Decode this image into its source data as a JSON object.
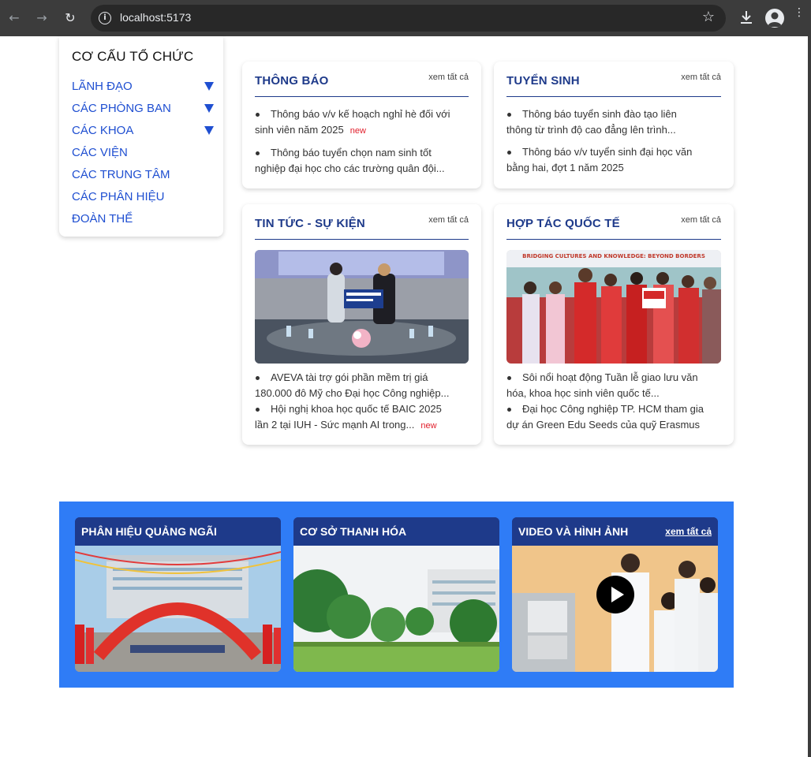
{
  "browser": {
    "url": "localhost:5173",
    "icons": [
      "back-icon",
      "forward-icon",
      "reload-icon",
      "info-icon",
      "star-icon",
      "download-icon",
      "profile-icon",
      "kebab-menu-icon"
    ]
  },
  "sidebar": {
    "title": "CƠ CẤU TỔ CHỨC",
    "items": [
      {
        "label": "LÃNH ĐẠO",
        "expandable": true
      },
      {
        "label": "CÁC PHÒNG BAN",
        "expandable": true
      },
      {
        "label": "CÁC KHOA",
        "expandable": true
      },
      {
        "label": "CÁC VIỆN",
        "expandable": false
      },
      {
        "label": "CÁC TRUNG TÂM",
        "expandable": false
      },
      {
        "label": "CÁC PHÂN HIỆU",
        "expandable": false
      },
      {
        "label": "ĐOÀN THỂ",
        "expandable": false
      }
    ]
  },
  "sections": {
    "thong_bao": {
      "title": "THÔNG BÁO",
      "more": "xem tất cả",
      "items": [
        {
          "line1": "Thông báo v/v kế hoạch nghỉ hè đối với",
          "line2": "sinh viên năm 2025",
          "tag": "new"
        },
        {
          "line1": "Thông báo tuyển chọn nam sinh tốt",
          "line2": "nghiệp đại học cho các trường quân đội..."
        }
      ]
    },
    "tuyen_sinh": {
      "title": "TUYỂN SINH",
      "more": "xem tất cả",
      "items": [
        {
          "line1": "Thông báo tuyển sinh đào tạo liên",
          "line2": "thông từ trình độ cao đẳng lên trình..."
        },
        {
          "line1": "Thông báo v/v tuyển sinh đại học văn",
          "line2": "bằng hai, đợt 1 năm 2025"
        }
      ]
    },
    "tin_tuc": {
      "title": "TIN TỨC - SỰ KIỆN",
      "more": "xem tất cả",
      "items": [
        {
          "line1": "AVEVA tài trợ gói phần mềm trị giá",
          "line2": "180.000 đô Mỹ cho Đại học Công nghiệp..."
        },
        {
          "line1": "Hội nghị khoa học quốc tế BAIC 2025",
          "line2": "lần 2 tại IUH - Sức mạnh AI trong...",
          "tag": "new"
        }
      ]
    },
    "hop_tac": {
      "title": "HỢP TÁC QUỐC TẾ",
      "more": "xem tất cả",
      "banner": "BRIDGING CULTURES AND KNOWLEDGE: BEYOND BORDERS",
      "items": [
        {
          "line1": "Sôi nổi hoạt động Tuần lễ giao lưu văn",
          "line2": "hóa, khoa học sinh viên quốc tế..."
        },
        {
          "line1": "Đại học Công nghiệp TP. HCM tham gia",
          "line2": "dự án Green Edu Seeds của quỹ Erasmus"
        }
      ]
    }
  },
  "bottom": {
    "cards": [
      {
        "title": "PHÂN HIỆU QUẢNG NGÃI"
      },
      {
        "title": "CƠ SỞ THANH HÓA"
      },
      {
        "title": "VIDEO VÀ HÌNH ẢNH",
        "more": "xem tất cả"
      }
    ]
  },
  "colors": {
    "primary_dark": "#1e3a8a",
    "link_blue": "#1f4fd1",
    "band_blue": "#2f7cf6",
    "new_red": "#e11d2a"
  }
}
